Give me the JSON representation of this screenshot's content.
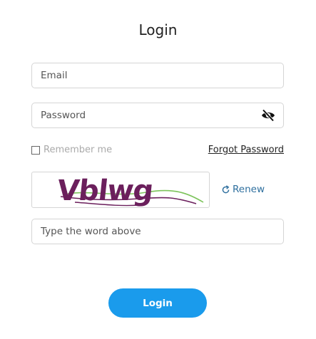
{
  "form": {
    "title": "Login",
    "email": {
      "value": "",
      "placeholder": "Email"
    },
    "password": {
      "value": "",
      "placeholder": "Password"
    },
    "password_toggle_icon": "eye-slash-icon",
    "remember_me": {
      "label": "Remember me",
      "checked": false
    },
    "forgot_password_label": "Forgot Password",
    "captcha": {
      "image_text": "Vblwg",
      "renew_label": "Renew",
      "renew_icon": "refresh-icon",
      "answer": {
        "value": "",
        "placeholder": "Type the word above"
      }
    },
    "submit_label": "Login"
  },
  "colors": {
    "accent": "#1a9bec",
    "link_blue": "#2e6f9e",
    "captcha_text": "#6b1f5c",
    "captcha_line": "#7cc35a"
  }
}
